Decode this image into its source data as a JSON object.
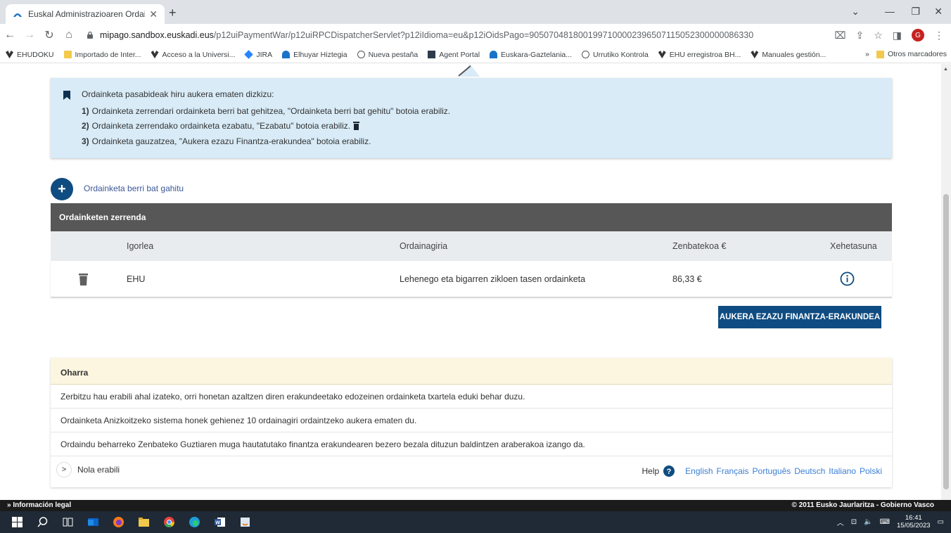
{
  "browser": {
    "tab_title": "Euskal Administrazioaren Ordain",
    "url_host": "mipago.sandbox.euskadi.eus",
    "url_path": "/p12uiPaymentWar/p12uiRPCDispatcherServlet?p12iIdioma=eu&p12iOidsPago=9050704818001997100002396507115052300000086330",
    "profile_initial": "G",
    "bookmarks": [
      "EHUDOKU",
      "Importado de Inter...",
      "Acceso a la Universi...",
      "JIRA",
      "Elhuyar Hiztegia",
      "Nueva pestaña",
      "Agent Portal",
      "Euskara-Gaztelania...",
      "Urrutiko Kontrola",
      "EHU erregistroa BH...",
      "Manuales gestión..."
    ],
    "bookmarks_overflow": "»",
    "other_bookmarks": "Otros marcadores"
  },
  "info": {
    "intro": "Ordainketa pasabideak hiru aukera ematen dizkizu:",
    "lines": [
      {
        "num": "1)",
        "text": "Ordainketa zerrendari ordainketa berri bat gehitzea, \"Ordainketa berri bat gehitu\" botoia erabiliz."
      },
      {
        "num": "2)",
        "text": "Ordainketa zerrendako ordainketa ezabatu, \"Ezabatu\" botoia erabiliz."
      },
      {
        "num": "3)",
        "text": "Ordainketa gauzatzea, \"Aukera ezazu Finantza-erakundea\" botoia erabiliz."
      }
    ]
  },
  "add_payment_label": "Ordainketa berri bat gahitu",
  "payments": {
    "title": "Ordainketen zerrenda",
    "columns": [
      "Igorlea",
      "Ordainagiria",
      "Zenbatekoa €",
      "Xehetasuna"
    ],
    "rows": [
      {
        "issuer": "EHU",
        "document": "Lehenego eta bigarren zikloen tasen ordainketa",
        "amount": "86,33 €"
      }
    ]
  },
  "choose_bank_label": "AUKERA EZAZU FINANTZA-ERAKUNDEA",
  "notes": {
    "title": "Oharra",
    "items": [
      "Zerbitzu hau erabili ahal izateko, orri honetan azaltzen diren erakundeetako edozeinen ordainketa txartela eduki behar duzu.",
      "Ordainketa Anizkoitzeko sistema honek gehienez 10 ordainagiri ordaintzeko aukera ematen du.",
      "Ordaindu beharreko Zenbateko Guztiaren muga hautatutako finantza erakundearen bezero bezala dituzun baldintzen araberakoa izango da."
    ],
    "how_to": "Nola erabili",
    "help": "Help",
    "languages": [
      "English",
      "Français",
      "Português",
      "Deutsch",
      "Italiano",
      "Polski"
    ]
  },
  "footer": {
    "left": "» Información legal",
    "right": "© 2011 Eusko Jaurlaritza - Gobierno Vasco"
  },
  "taskbar": {
    "time": "16:41",
    "date": "15/05/2023"
  },
  "colors": {
    "primary": "#0f4c81",
    "info_bg": "#d8ebf7",
    "header_bg": "#575757",
    "note_bg": "#fcf6e0",
    "link": "#3b7fd4"
  }
}
